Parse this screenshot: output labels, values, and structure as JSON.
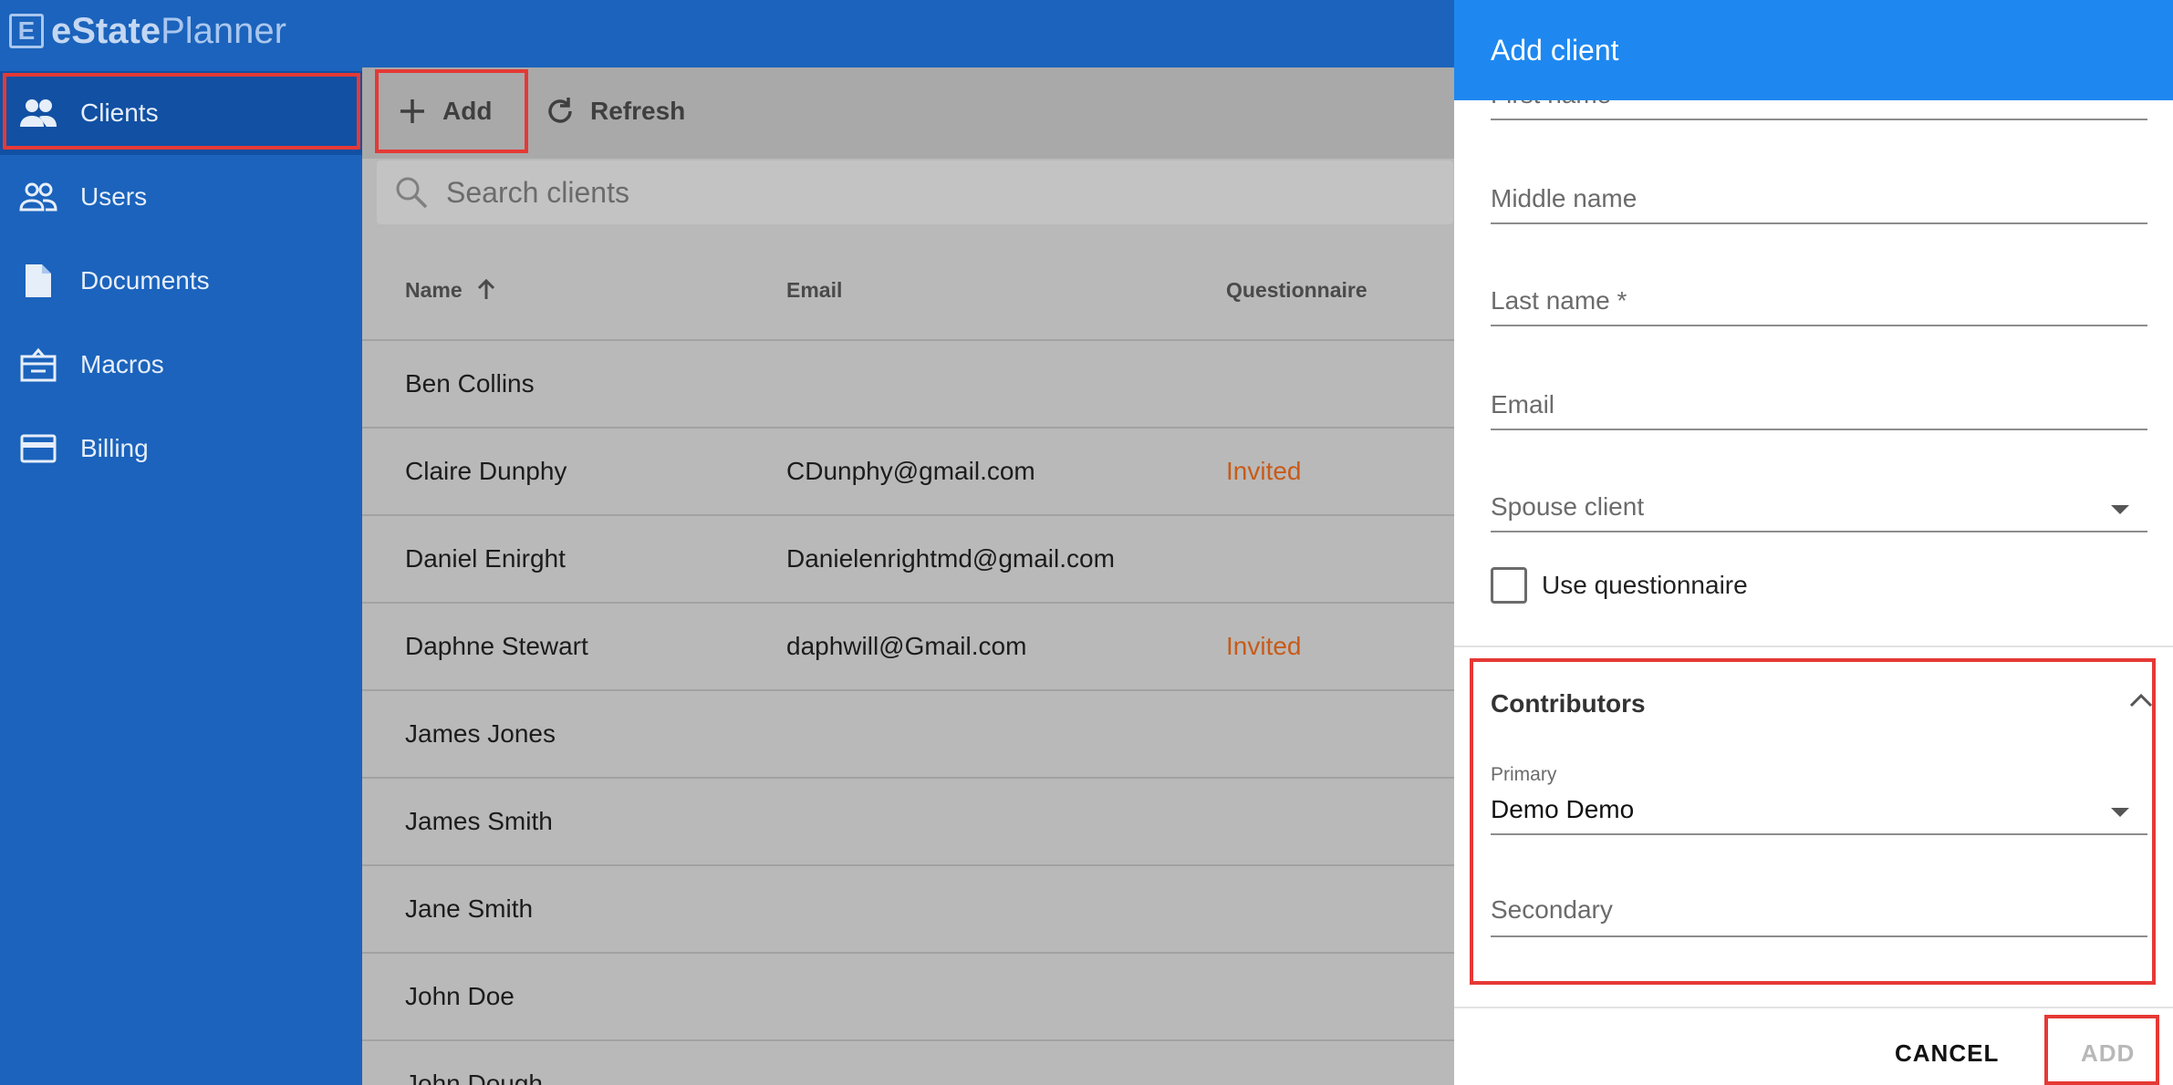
{
  "app": {
    "logo_prefix": "eState",
    "logo_suffix": "Planner",
    "logo_mark": "E"
  },
  "sidebar": {
    "items": [
      {
        "label": "Clients",
        "icon": "people-icon"
      },
      {
        "label": "Users",
        "icon": "people-outline-icon"
      },
      {
        "label": "Documents",
        "icon": "document-icon"
      },
      {
        "label": "Macros",
        "icon": "macro-icon"
      },
      {
        "label": "Billing",
        "icon": "credit-card-icon"
      }
    ]
  },
  "toolbar": {
    "add_label": "Add",
    "refresh_label": "Refresh"
  },
  "search": {
    "placeholder": "Search clients"
  },
  "table": {
    "headers": {
      "name": "Name",
      "email": "Email",
      "questionnaire": "Questionnaire"
    },
    "rows": [
      {
        "name": "Ben Collins",
        "email": "",
        "status": ""
      },
      {
        "name": "Claire Dunphy",
        "email": "CDunphy@gmail.com",
        "status": "Invited"
      },
      {
        "name": "Daniel Enirght",
        "email": "Danielenrightmd@gmail.com",
        "status": ""
      },
      {
        "name": "Daphne Stewart",
        "email": "daphwill@Gmail.com",
        "status": "Invited"
      },
      {
        "name": "James Jones",
        "email": "",
        "status": ""
      },
      {
        "name": "James Smith",
        "email": "",
        "status": ""
      },
      {
        "name": "Jane Smith",
        "email": "",
        "status": ""
      },
      {
        "name": "John Doe",
        "email": "",
        "status": ""
      },
      {
        "name": "John Dough",
        "email": "",
        "status": ""
      }
    ]
  },
  "drawer": {
    "title": "Add client",
    "fields": {
      "first_name": "First name",
      "middle_name": "Middle name",
      "last_name": "Last name *",
      "email": "Email",
      "spouse_client": "Spouse client",
      "use_questionnaire": "Use questionnaire"
    },
    "contributors": {
      "title": "Contributors",
      "primary_label": "Primary",
      "primary_value": "Demo Demo",
      "secondary_label": "Secondary"
    },
    "cancel_label": "CANCEL",
    "add_label": "ADD"
  },
  "colors": {
    "sidebar": "#1b63bc",
    "drawer_header": "#1e88f0",
    "invited": "#c75b18",
    "highlight": "#e53935"
  }
}
